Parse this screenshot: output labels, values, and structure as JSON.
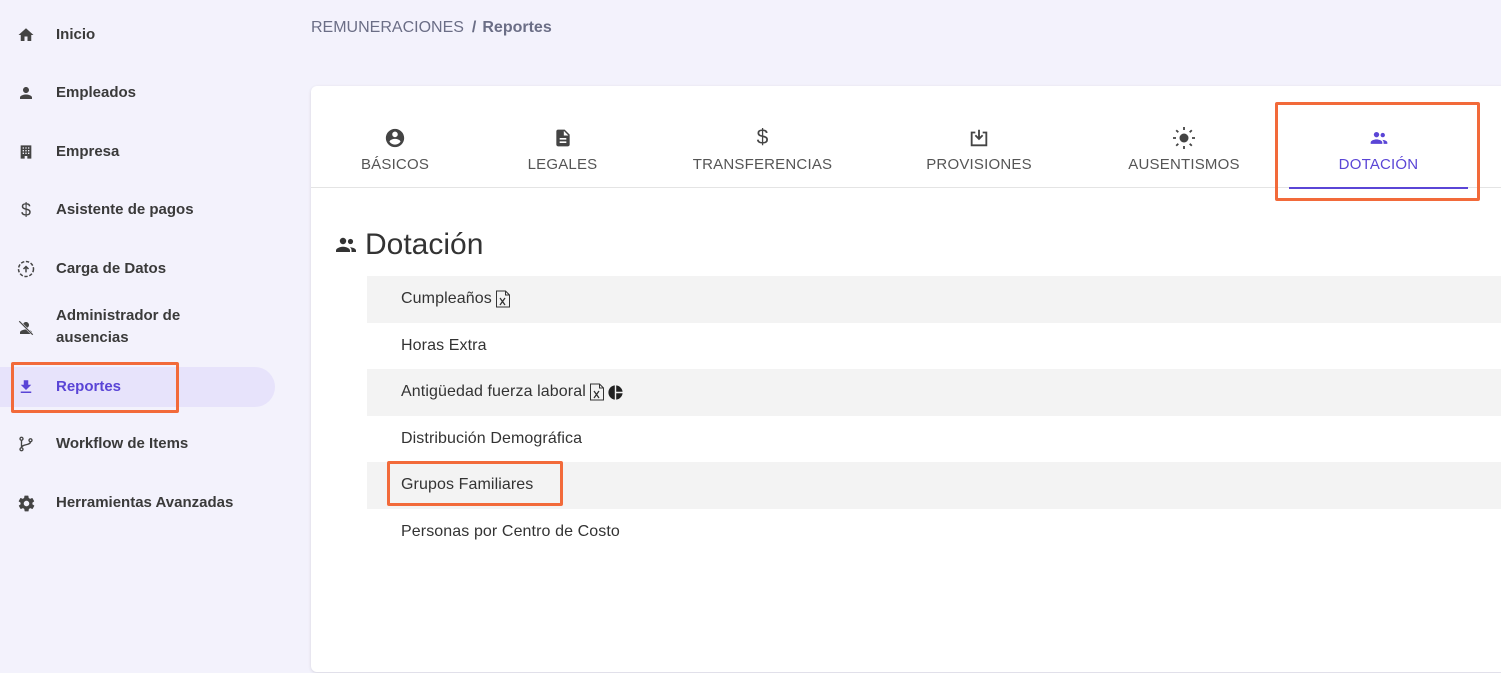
{
  "sidebar": {
    "items": [
      {
        "label": "Inicio",
        "icon": "home-icon"
      },
      {
        "label": "Empleados",
        "icon": "person-icon"
      },
      {
        "label": "Empresa",
        "icon": "building-icon"
      },
      {
        "label": "Asistente de pagos",
        "icon": "dollar-icon"
      },
      {
        "label": "Carga de Datos",
        "icon": "upload-circle-icon"
      },
      {
        "label": "Administrador de ausencias",
        "icon": "person-off-icon"
      },
      {
        "label": "Reportes",
        "icon": "download-icon",
        "active": true
      },
      {
        "label": "Workflow de Items",
        "icon": "branch-icon"
      },
      {
        "label": "Herramientas Avanzadas",
        "icon": "gear-icon"
      }
    ]
  },
  "breadcrumb": {
    "parent": "REMUNERACIONES",
    "separator": "/",
    "current": "Reportes"
  },
  "tabs": [
    {
      "label": "BÁSICOS",
      "icon": "account-circle-icon"
    },
    {
      "label": "LEGALES",
      "icon": "document-icon"
    },
    {
      "label": "TRANSFERENCIAS",
      "icon": "dollar-icon"
    },
    {
      "label": "PROVISIONES",
      "icon": "download-box-icon"
    },
    {
      "label": "AUSENTISMOS",
      "icon": "sun-icon"
    },
    {
      "label": "DOTACIÓN",
      "icon": "people-icon",
      "active": true
    }
  ],
  "section": {
    "title": "Dotación",
    "icon": "people-icon"
  },
  "reports": [
    {
      "label": "Cumpleaños",
      "icons": [
        "excel-icon"
      ]
    },
    {
      "label": "Horas Extra",
      "icons": []
    },
    {
      "label": "Antigüedad fuerza laboral",
      "icons": [
        "excel-icon",
        "pie-chart-icon"
      ]
    },
    {
      "label": "Distribución Demográfica",
      "icons": []
    },
    {
      "label": "Grupos Familiares",
      "icons": []
    },
    {
      "label": "Personas por Centro de Costo",
      "icons": []
    }
  ],
  "colors": {
    "accent": "#5a45d6",
    "highlight": "#f26a3a",
    "background": "#f3f2fc",
    "active_bg": "#e7e3fb"
  }
}
